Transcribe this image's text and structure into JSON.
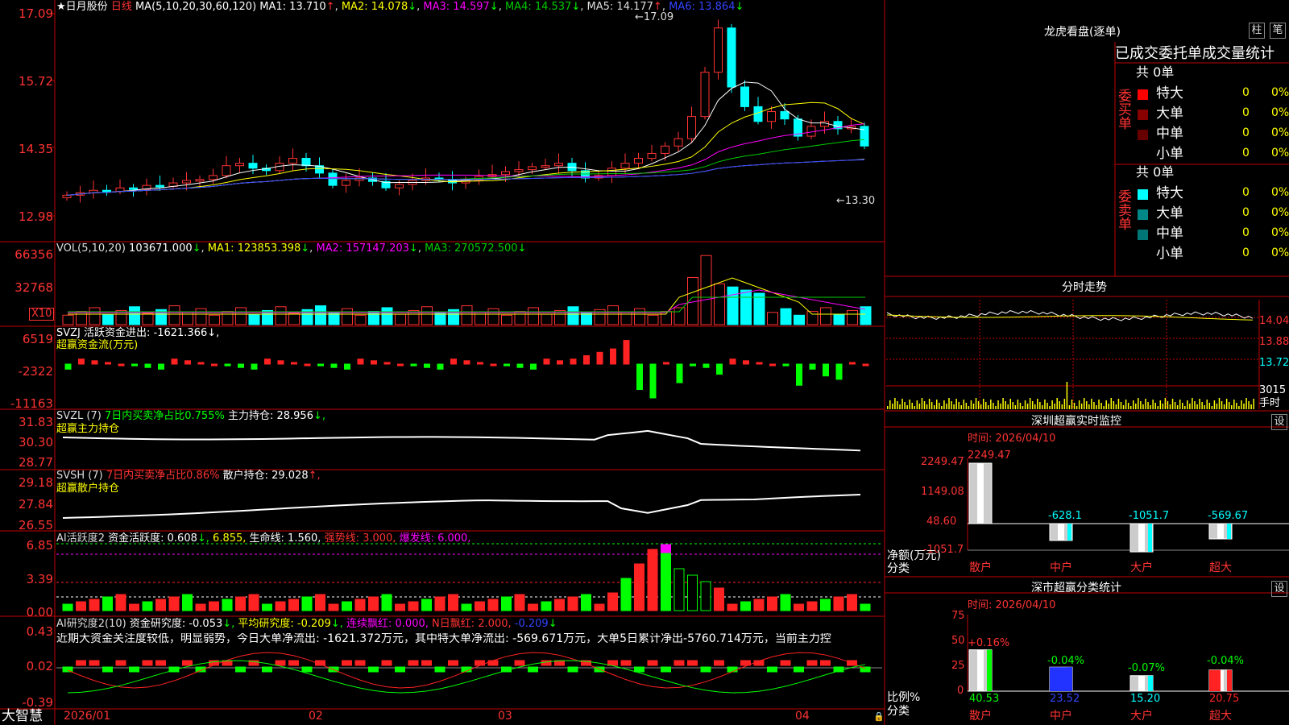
{
  "stock": {
    "name": "日月股份",
    "period": "日线"
  },
  "main_legend": {
    "prefix": "MA(5,10,20,30,60,120)",
    "ma1": "MA1: 13.710",
    "ma2": "MA2: 14.078",
    "ma3": "MA3: 14.597",
    "ma4": "MA4: 14.537",
    "ma5": "MA5: 14.177",
    "ma6": "MA6: 13.864",
    "arrow_up": "↑",
    "arrow_down": "↓"
  },
  "main_axis": [
    "17.09",
    "15.72",
    "14.35",
    "12.98"
  ],
  "price_marks": {
    "high": "17.09",
    "low": "13.30"
  },
  "vol_legend": {
    "prefix": "VOL(5,10,20)",
    "vol": "103671.000",
    "ma1": "MA1: 123853.398",
    "ma2": "MA2: 157147.203",
    "ma3": "MA3: 270572.500"
  },
  "vol_axis": [
    "66356",
    "32768"
  ],
  "vol_unit": "X10",
  "svzj": {
    "line1": "SVZJ  活跃资金进出: -1621.366",
    "line1_suffix": "↓,",
    "line2": "超赢资金流(万元)",
    "axis": [
      "6519",
      "-2322",
      "-11163"
    ]
  },
  "svzl": {
    "prefix": "SVZL  (7)",
    "pct": "7日内买卖净占比0.755%",
    "hold": "主力持仓: 28.956",
    "hold_suffix": "↓,",
    "line2": "超赢主力持仓",
    "axis": [
      "31.83",
      "30.30",
      "28.77"
    ]
  },
  "svsh": {
    "prefix": "SVSH  (7)",
    "pct": "7日内买卖净占比0.86%",
    "hold": "散户持仓: 29.028",
    "hold_suffix": "↑,",
    "line2": "超赢散户持仓",
    "axis": [
      "29.18",
      "27.84",
      "26.55"
    ]
  },
  "ai2": {
    "prefix": "AI活跃度2",
    "a": "资金活跃度: 0.608",
    "a_suffix": "↓,",
    "b": "6.855",
    "b_suffix": ",",
    "c": "生命线: 1.560,",
    "d": "强势线: 3.000,",
    "e": "爆发线: 6.000,",
    "axis": [
      "6.85",
      "3.39",
      "0.00"
    ]
  },
  "research": {
    "prefix": "AI研究度2(10)",
    "a": "资金研究度: -0.053",
    "a_suffix": "↓,",
    "b": "平均研究度: -0.209",
    "b_suffix": "↓,",
    "c": "连续飘红: 0.000,",
    "d": "N日飘红: 2.000,",
    "e": "-0.209",
    "e_suffix": "↓",
    "comment": "近期大资金关注度较低，明显弱势，今日大单净流出: -1621.372万元，其中特大单净流出: -569.671万元，大单5日累计净出-5760.714万元，当前主力控",
    "axis": [
      "0.43",
      "0.02",
      "-0.39"
    ]
  },
  "date_axis": {
    "brand": "大智慧",
    "labels": [
      "2026/01",
      "02",
      "03",
      "04"
    ]
  },
  "dragon": {
    "title": "龙虎看盘(逐单)",
    "btn_bar": "柱",
    "btn_tick": "笔",
    "subtitle": "已成交委托单成交量统计",
    "buy_label": "委买单",
    "sell_label": "委卖单",
    "buy_total": "共 0单",
    "sell_total": "共 0单",
    "buy_rows": [
      {
        "label": "特大",
        "count": "0",
        "pct": "0%",
        "color": "#ff0000"
      },
      {
        "label": "大单",
        "count": "0",
        "pct": "0%",
        "color": "#880000"
      },
      {
        "label": "中单",
        "count": "0",
        "pct": "0%",
        "color": "#660000"
      },
      {
        "label": "小单",
        "count": "0",
        "pct": "0%",
        "color": "#000000"
      }
    ],
    "sell_rows": [
      {
        "label": "特大",
        "count": "0",
        "pct": "0%",
        "color": "#00ffff"
      },
      {
        "label": "大单",
        "count": "0",
        "pct": "0%",
        "color": "#008888"
      },
      {
        "label": "中单",
        "count": "0",
        "pct": "0%",
        "color": "#007777"
      },
      {
        "label": "小单",
        "count": "0",
        "pct": "0%",
        "color": "#000000"
      }
    ]
  },
  "intraday": {
    "title": "分时走势",
    "axis": [
      "14.04",
      "13.88",
      "13.72"
    ],
    "vol_label": "3015",
    "unit": "手",
    "ylabel": "时"
  },
  "monitor": {
    "title": "深圳超赢实时监控",
    "set": "设",
    "time": "时间: 2026/04/10",
    "axis": [
      "2249.47",
      "1149.08",
      "48.60",
      "-1051.7"
    ],
    "ylabel1": "净额(万元)",
    "ylabel2": "分类",
    "categories": [
      "散户",
      "中户",
      "大户",
      "超大"
    ],
    "values": [
      2249.47,
      -628.1,
      -1051.7,
      -569.67
    ],
    "labels": [
      "2249.47",
      "-628.1",
      "-1051.7",
      "-569.67"
    ]
  },
  "classify": {
    "title": "深市超赢分类统计",
    "set": "设",
    "time": "时间: 2026/04/10",
    "axis": [
      "75",
      "50",
      "25",
      "0"
    ],
    "ylabel1": "比例%",
    "ylabel2": "分类",
    "categories": [
      "散户",
      "中户",
      "大户",
      "超大"
    ],
    "values": [
      40.53,
      23.52,
      15.2,
      20.75
    ],
    "value_labels": [
      "40.53",
      "23.52",
      "15.20",
      "20.75"
    ],
    "deltas": [
      "+0.16%",
      "-0.04%",
      "-0.07%",
      "-0.04%"
    ]
  },
  "chart_data": {
    "type": "bar",
    "title": "深圳超赢实时监控",
    "categories": [
      "散户",
      "中户",
      "大户",
      "超大"
    ],
    "series": [
      {
        "name": "净额(万元)",
        "values": [
          2249.47,
          -628.1,
          -1051.7,
          -569.67
        ]
      },
      {
        "name": "比例%",
        "values": [
          40.53,
          23.52,
          15.2,
          20.75
        ]
      }
    ]
  },
  "colors": {
    "up": "#ff3333",
    "down": "#00ffff",
    "green": "#00ff00",
    "frame": "#c00000",
    "ma1": "#ffffff",
    "ma2": "#ffff00",
    "ma3": "#ff00ff",
    "ma4": "#00cc00",
    "ma5": "#dddddd",
    "ma6": "#3333ff"
  }
}
